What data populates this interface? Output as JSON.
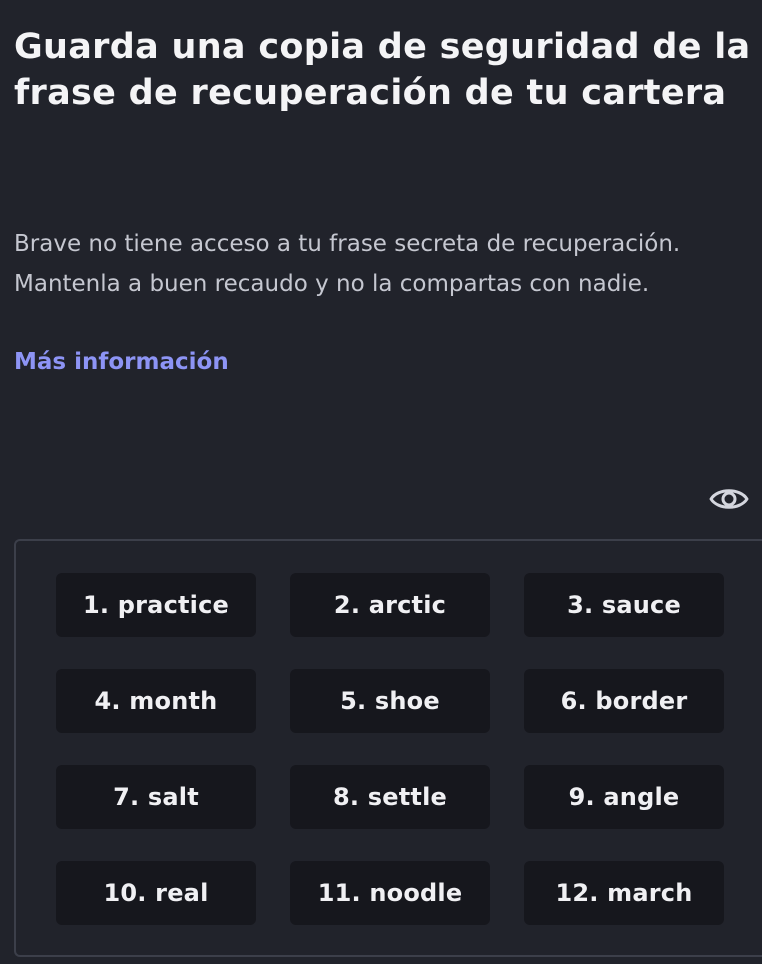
{
  "header": {
    "title": "Guarda una copia de seguridad de la frase de recuperación de tu cartera"
  },
  "content": {
    "description": "Brave no tiene acceso a tu frase secreta de recuperación. Mantenla a buen recaudo y no la compartas con nadie.",
    "learn_more": "Más información"
  },
  "controls": {
    "visibility_icon": "eye-icon"
  },
  "recovery_phrase": {
    "words": [
      "1. practice",
      "2. arctic",
      "3. sauce",
      "4. month",
      "5. shoe",
      "6. border",
      "7. salt",
      "8. settle",
      "9. angle",
      "10. real",
      "11. noodle",
      "12. march"
    ]
  },
  "colors": {
    "background": "#21232b",
    "title": "#f4f4f6",
    "body_text": "#c5c7d0",
    "link": "#8d94f5",
    "word_chip": "#16171d",
    "box_border": "#3c3f4a"
  }
}
